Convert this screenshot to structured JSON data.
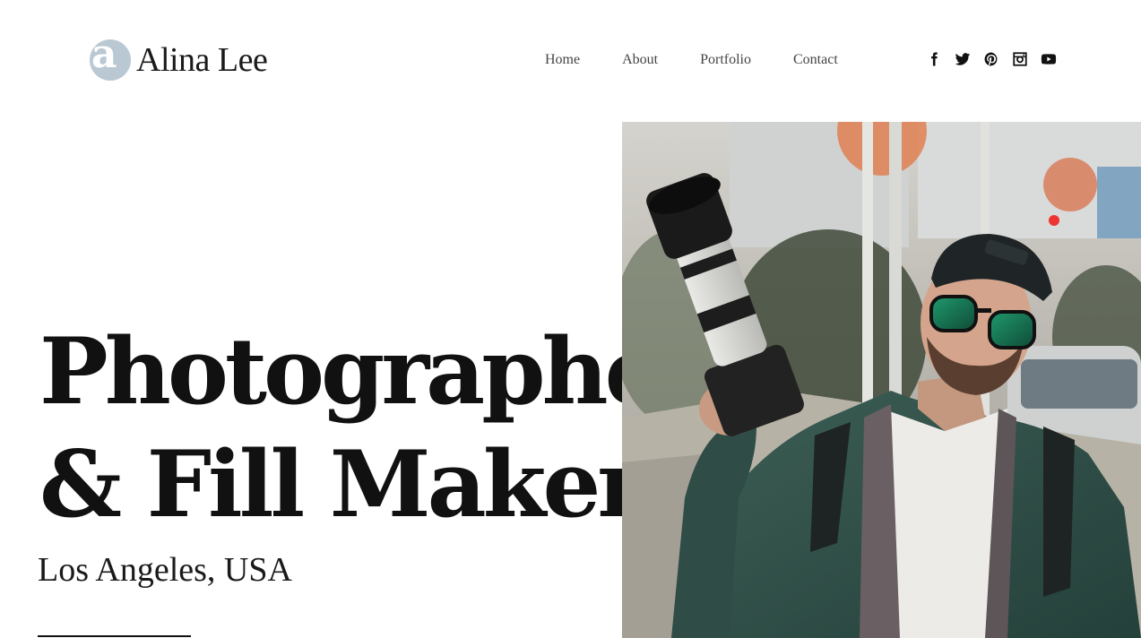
{
  "header": {
    "logo_letter": "a",
    "logo_name": "Alina Lee",
    "nav": [
      "Home",
      "About",
      "Portfolio",
      "Contact"
    ],
    "social": [
      "facebook-icon",
      "twitter-icon",
      "pinterest-icon",
      "instagram-icon",
      "youtube-icon"
    ]
  },
  "hero": {
    "title_line1": "Photographer",
    "title_line2": "& Fill Maker",
    "location": "Los Angeles, USA"
  },
  "colors": {
    "logo_circle": "#b9c8d3",
    "text": "#111111",
    "background": "#ffffff"
  }
}
